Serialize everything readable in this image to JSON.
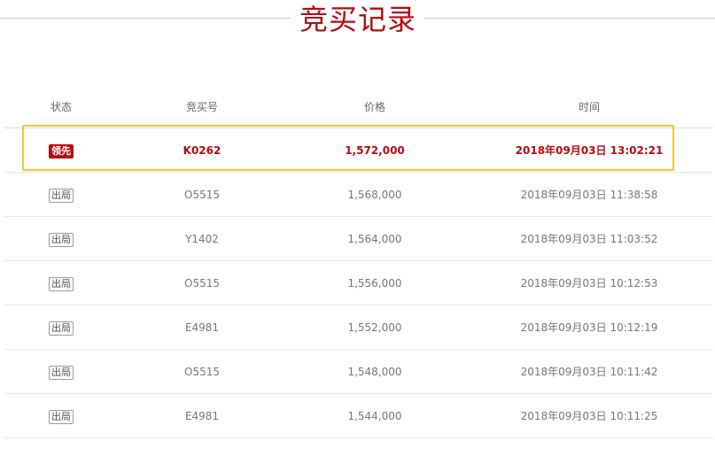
{
  "page": {
    "title": "竞买记录"
  },
  "table": {
    "headers": {
      "status": "状态",
      "code": "竞买号",
      "price": "价格",
      "time": "时间"
    },
    "rows": [
      {
        "status": "领先",
        "code": "K0262",
        "price": "1,572,000",
        "time": "2018年09月03日 13:02:21"
      },
      {
        "status": "出局",
        "code": "O5515",
        "price": "1,568,000",
        "time": "2018年09月03日 11:38:58"
      },
      {
        "status": "出局",
        "code": "Y1402",
        "price": "1,564,000",
        "time": "2018年09月03日 11:03:52"
      },
      {
        "status": "出局",
        "code": "O5515",
        "price": "1,556,000",
        "time": "2018年09月03日 10:12:53"
      },
      {
        "status": "出局",
        "code": "E4981",
        "price": "1,552,000",
        "time": "2018年09月03日 10:12:19"
      },
      {
        "status": "出局",
        "code": "O5515",
        "price": "1,548,000",
        "time": "2018年09月03日 10:11:42"
      },
      {
        "status": "出局",
        "code": "E4981",
        "price": "1,544,000",
        "time": "2018年09月03日 10:11:25"
      }
    ]
  },
  "colors": {
    "accent": "#b30b12",
    "highlight_border": "#f2c531"
  }
}
